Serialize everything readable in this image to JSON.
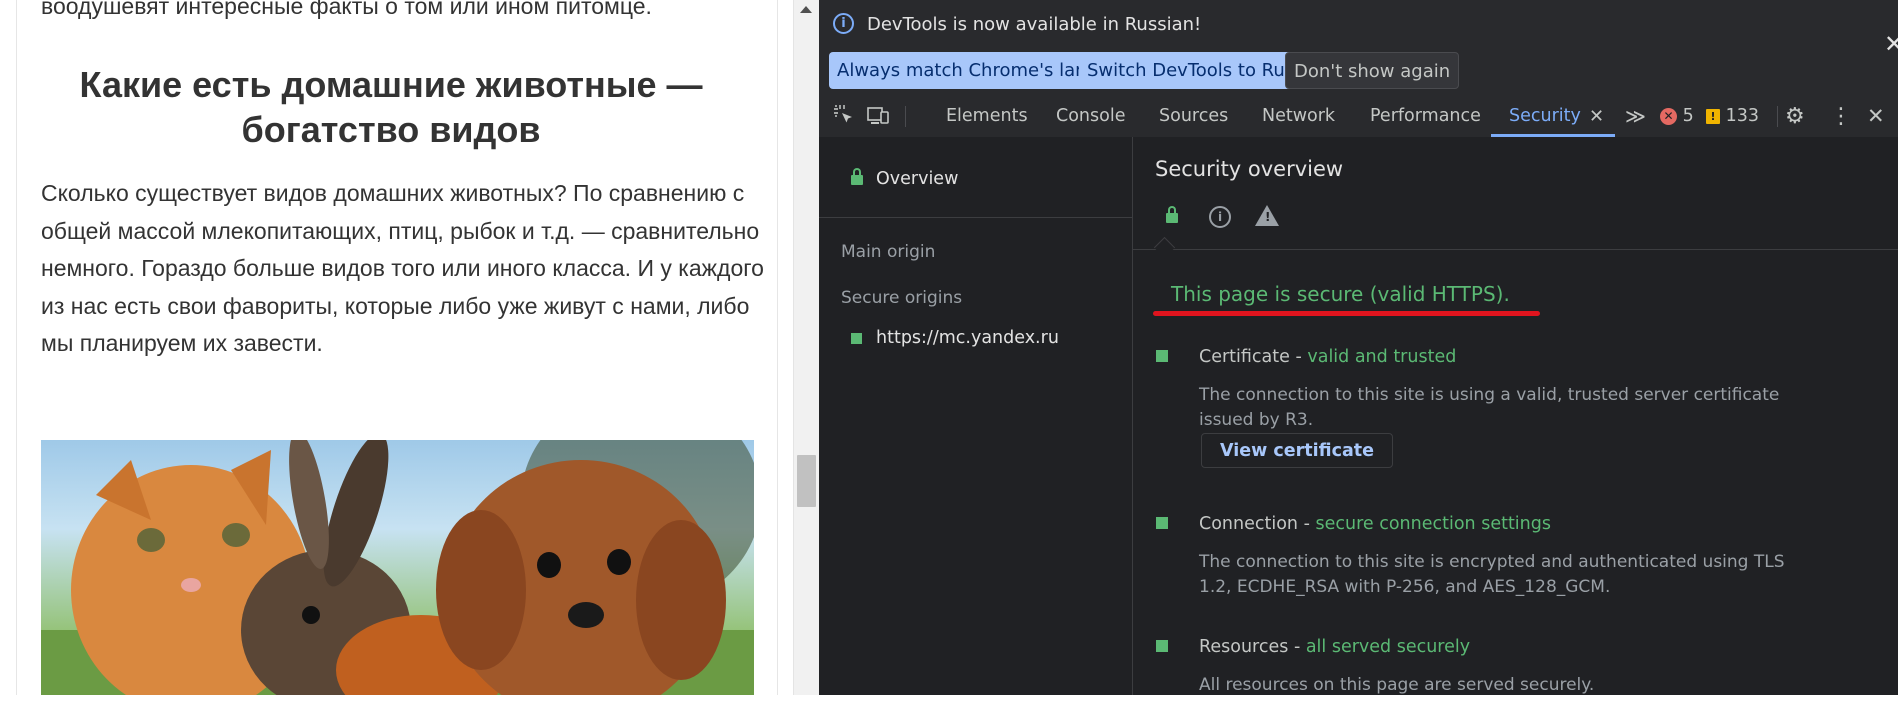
{
  "article": {
    "lead_fragment": "воодушевят интересные факты о том или ином питомце.",
    "heading_line1": "Какие есть домашние животные —",
    "heading_line2": "богатство видов",
    "paragraph": "Сколько существует видов домашних животных? По сравнению с общей массой млекопитающих, птиц, рыбок и т.д. — сравнительно немного. Гораздо больше видов того или иного класса. И у каждого из нас есть свои фавориты, которые либо уже живут с нами, либо мы планируем их завести.",
    "image_subject": "kitten-rabbit-guinea-pig-puppy-photo"
  },
  "devtools": {
    "infobar": {
      "message": "DevTools is now available in Russian!",
      "buttons": {
        "match_language": "Always match Chrome's language",
        "switch_russian": "Switch DevTools to Russian",
        "dont_show": "Don't show again"
      },
      "close": "✕"
    },
    "tabs": [
      "Elements",
      "Console",
      "Sources",
      "Network",
      "Performance",
      "Security"
    ],
    "active_tab": "Security",
    "active_tab_close": "✕",
    "more_tabs": "≫",
    "error_count": "5",
    "warning_count": "133",
    "sidebar": {
      "overview": "Overview",
      "main_origin": "Main origin",
      "secure_origins": "Secure origins",
      "origin_url": "https://mc.yandex.ru"
    },
    "main": {
      "title": "Security overview",
      "summary": "This page is secure (valid HTTPS).",
      "items": [
        {
          "title": "Certificate",
          "status": "valid and trusted",
          "description": "The connection to this site is using a valid, trusted server certificate issued by R3."
        },
        {
          "title": "Connection",
          "status": "secure connection settings",
          "description": "The connection to this site is encrypted and authenticated using TLS 1.2, ECDHE_RSA with P-256, and AES_128_GCM."
        },
        {
          "title": "Resources",
          "status": "all served securely",
          "description": "All resources on this page are served securely."
        }
      ],
      "view_certificate": "View certificate",
      "separator": " - "
    },
    "colors": {
      "secure_green": "#5bb974",
      "accent_blue": "#7cacf8",
      "annotation_red": "#e0141e",
      "error_red": "#e46962",
      "warning_amber": "#f0b400"
    }
  }
}
